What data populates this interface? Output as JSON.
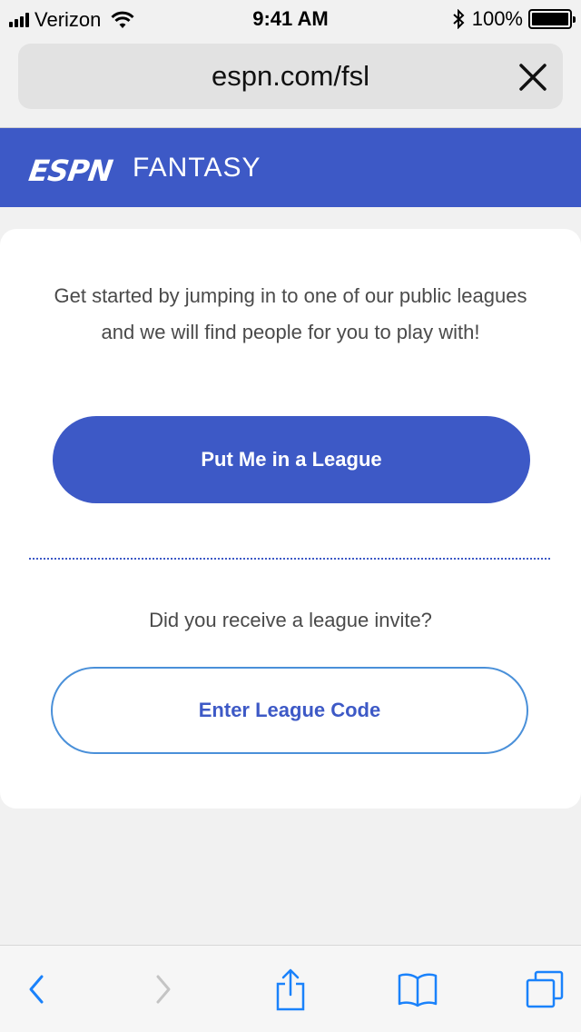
{
  "status_bar": {
    "carrier": "Verizon",
    "time": "9:41 AM",
    "battery_percent": "100%",
    "signal_icon": "cellular-signal-icon",
    "wifi_icon": "wifi-icon",
    "bluetooth_icon": "bluetooth-icon",
    "battery_icon": "battery-icon"
  },
  "browser": {
    "url": "espn.com/fsl",
    "close_icon": "close-icon"
  },
  "header": {
    "logo_text": "ESPN",
    "section_label": "FANTASY",
    "background_color": "#3d59c6"
  },
  "card": {
    "intro_text": "Get started by jumping in to one of our public leagues and we will find people for you to play with!",
    "primary_button": "Put Me in a League",
    "invite_question": "Did you receive a league invite?",
    "secondary_button": "Enter League Code"
  },
  "toolbar": {
    "items": [
      {
        "icon": "back-chevron-icon",
        "enabled": true
      },
      {
        "icon": "forward-chevron-icon",
        "enabled": false
      },
      {
        "icon": "share-icon",
        "enabled": true
      },
      {
        "icon": "bookmarks-icon",
        "enabled": true
      },
      {
        "icon": "tabs-icon",
        "enabled": true
      }
    ],
    "accent_color": "#1a82fb"
  }
}
